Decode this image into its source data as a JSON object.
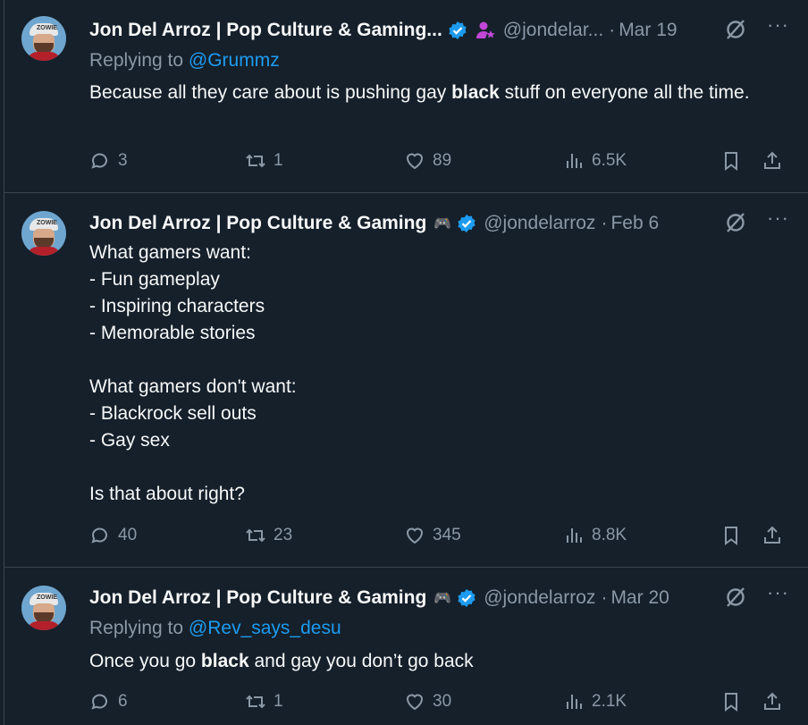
{
  "tweets": [
    {
      "name": "Jon Del Arroz | Pop Culture & Gaming...",
      "handle": "@jondelar...",
      "date": "Mar 19",
      "replying_prefix": "Replying to ",
      "replying_to": "@Grummz",
      "body": [
        {
          "text": "Because all they care about is pushing gay ",
          "bold": false
        },
        {
          "text": "black",
          "bold": true
        },
        {
          "text": " stuff on everyone all the time.",
          "bold": false
        }
      ],
      "replies": "3",
      "reposts": "1",
      "likes": "89",
      "views": "6.5K"
    },
    {
      "name": "Jon Del Arroz | Pop Culture & Gaming",
      "handle": "@jondelarroz",
      "date": "Feb 6",
      "body_lines": [
        "What gamers want:",
        "- Fun gameplay",
        "- Inspiring characters",
        "- Memorable stories",
        "",
        "What gamers don't want:",
        "- Blackrock sell outs",
        "- Gay sex",
        "",
        "Is that about right?"
      ],
      "replies": "40",
      "reposts": "23",
      "likes": "345",
      "views": "8.8K"
    },
    {
      "name": "Jon Del Arroz | Pop Culture & Gaming",
      "handle": "@jondelarroz",
      "date": "Mar 20",
      "replying_prefix": "Replying to ",
      "replying_to": "@Rev_says_desu",
      "body": [
        {
          "text": "Once you go ",
          "bold": false
        },
        {
          "text": "black",
          "bold": true
        },
        {
          "text": " and gay you don’t go back",
          "bold": false
        }
      ],
      "replies": "6",
      "reposts": "1",
      "likes": "30",
      "views": "2.1K"
    }
  ],
  "separator": "·",
  "more_glyph": "···",
  "avatar_cap_text": "ZOWIE",
  "gamepad_glyph": "🎮",
  "colors": {
    "background": "#15202b",
    "text": "#f7f9f9",
    "muted": "#8b98a5",
    "link": "#1d9bf0",
    "verified": "#1d9bf0",
    "affiliate": "#c147d6"
  },
  "icons": [
    "verified-badge-icon",
    "affiliate-badge-icon",
    "gamepad-icon",
    "grok-icon",
    "more-icon",
    "reply-icon",
    "repost-icon",
    "like-icon",
    "views-icon",
    "bookmark-icon",
    "share-icon"
  ]
}
